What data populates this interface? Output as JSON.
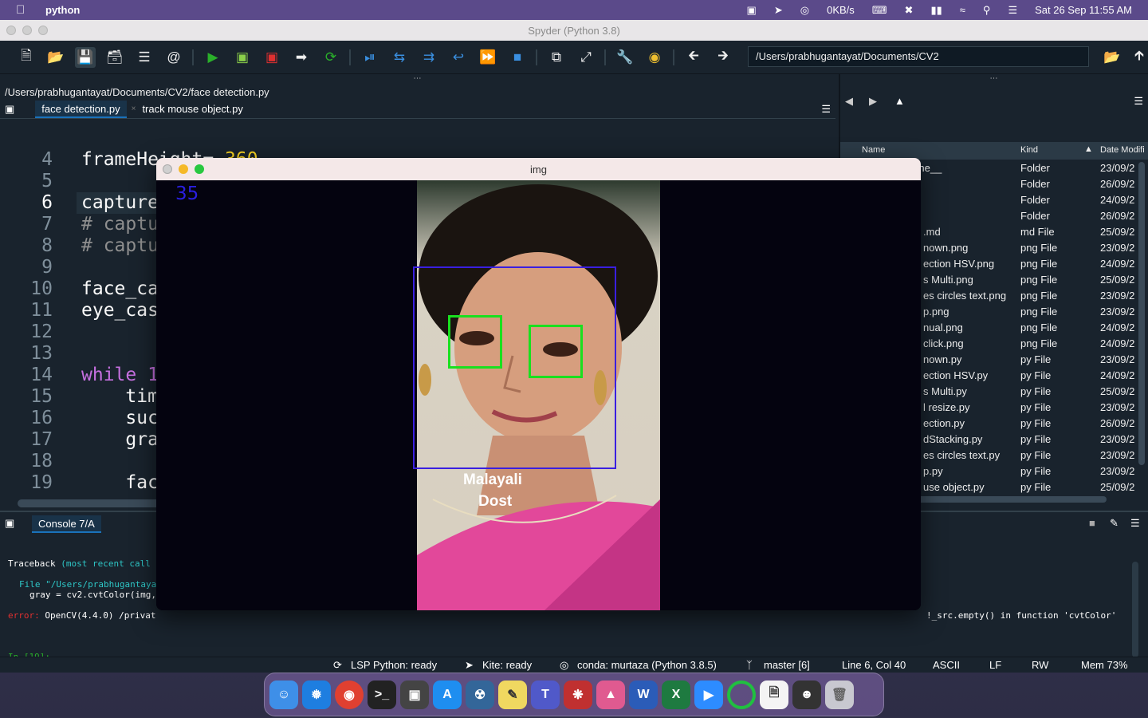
{
  "menubar": {
    "app_name": "python",
    "network_speed": "0KB/s",
    "datetime": "Sat 26 Sep  11:55 AM"
  },
  "window": {
    "title": "Spyder (Python 3.8)"
  },
  "toolbar": {
    "working_dir": "/Users/prabhugantayat/Documents/CV2"
  },
  "editor": {
    "file_path": "/Users/prabhugantayat/Documents/CV2/face detection.py",
    "tabs": [
      {
        "label": "face detection.py",
        "active": true
      },
      {
        "label": "track mouse object.py",
        "active": false
      }
    ],
    "lines": [
      {
        "num": "4",
        "text": "frameHeight= 360"
      },
      {
        "num": "5",
        "text": ""
      },
      {
        "num": "6",
        "text": "capture"
      },
      {
        "num": "7",
        "text": "# captu"
      },
      {
        "num": "8",
        "text": "# captu"
      },
      {
        "num": "9",
        "text": ""
      },
      {
        "num": "10",
        "text": "face_ca"
      },
      {
        "num": "11",
        "text": "eye_cas"
      },
      {
        "num": "12",
        "text": ""
      },
      {
        "num": "13",
        "text": ""
      },
      {
        "num": "14",
        "text": "while 1"
      },
      {
        "num": "15",
        "text": "    tim"
      },
      {
        "num": "16",
        "text": "    suc"
      },
      {
        "num": "17",
        "text": "    gra"
      },
      {
        "num": "18",
        "text": ""
      },
      {
        "num": "19",
        "text": "    fac"
      }
    ]
  },
  "file_explorer": {
    "columns": {
      "name": "Name",
      "kind": "Kind",
      "date": "Date Modifi"
    },
    "rows": [
      {
        "name": "__pycache__",
        "kind": "Folder",
        "date": "23/09/2"
      },
      {
        "name": "",
        "kind": "Folder",
        "date": "26/09/2"
      },
      {
        "name": "",
        "kind": "Folder",
        "date": "24/09/2"
      },
      {
        "name": "",
        "kind": "Folder",
        "date": "26/09/2"
      },
      {
        "name": ".md",
        "kind": "md File",
        "date": "25/09/2"
      },
      {
        "name": "nown.png",
        "kind": "png File",
        "date": "23/09/2"
      },
      {
        "name": "ection HSV.png",
        "kind": "png File",
        "date": "24/09/2"
      },
      {
        "name": "s Multi.png",
        "kind": "png File",
        "date": "25/09/2"
      },
      {
        "name": "es circles text.png",
        "kind": "png File",
        "date": "23/09/2"
      },
      {
        "name": "p.png",
        "kind": "png File",
        "date": "23/09/2"
      },
      {
        "name": "nual.png",
        "kind": "png File",
        "date": "24/09/2"
      },
      {
        "name": "click.png",
        "kind": "png File",
        "date": "24/09/2"
      },
      {
        "name": "nown.py",
        "kind": "py File",
        "date": "23/09/2"
      },
      {
        "name": "ection HSV.py",
        "kind": "py File",
        "date": "24/09/2"
      },
      {
        "name": "s Multi.py",
        "kind": "py File",
        "date": "25/09/2"
      },
      {
        "name": "l resize.py",
        "kind": "py File",
        "date": "23/09/2"
      },
      {
        "name": "ection.py",
        "kind": "py File",
        "date": "26/09/2"
      },
      {
        "name": "dStacking.py",
        "kind": "py File",
        "date": "23/09/2"
      },
      {
        "name": "es circles text.py",
        "kind": "py File",
        "date": "23/09/2"
      },
      {
        "name": "p.py",
        "kind": "py File",
        "date": "23/09/2"
      },
      {
        "name": "use object.py",
        "kind": "py File",
        "date": "25/09/2"
      }
    ]
  },
  "console": {
    "tab_label": "Console 7/A",
    "line1_a": "Traceback",
    "line1_b": "(most recent call",
    "line2": "File \"/Users/prabhugantaya",
    "line3": "gray = cv2.cvtColor(img,",
    "err_label": "error:",
    "err_text": "OpenCV(4.4.0) /privat",
    "err_tail": "!_src.empty() in function 'cvtColor'",
    "prompt": "In [19]:"
  },
  "statusbar": {
    "lsp": "LSP Python: ready",
    "kite": "Kite: ready",
    "conda": "conda: murtaza (Python 3.8.5)",
    "git": "master [6]",
    "position": "Line 6, Col 40",
    "encoding": "ASCII",
    "eol": "LF",
    "rw": "RW",
    "mem": "Mem 73%"
  },
  "img_window": {
    "title": "img",
    "fps": "35",
    "caption_line1": "Malayali",
    "caption_line2": "Dost",
    "face_box_color": "#3a1fe0",
    "eye_box_color": "#19e01f"
  }
}
